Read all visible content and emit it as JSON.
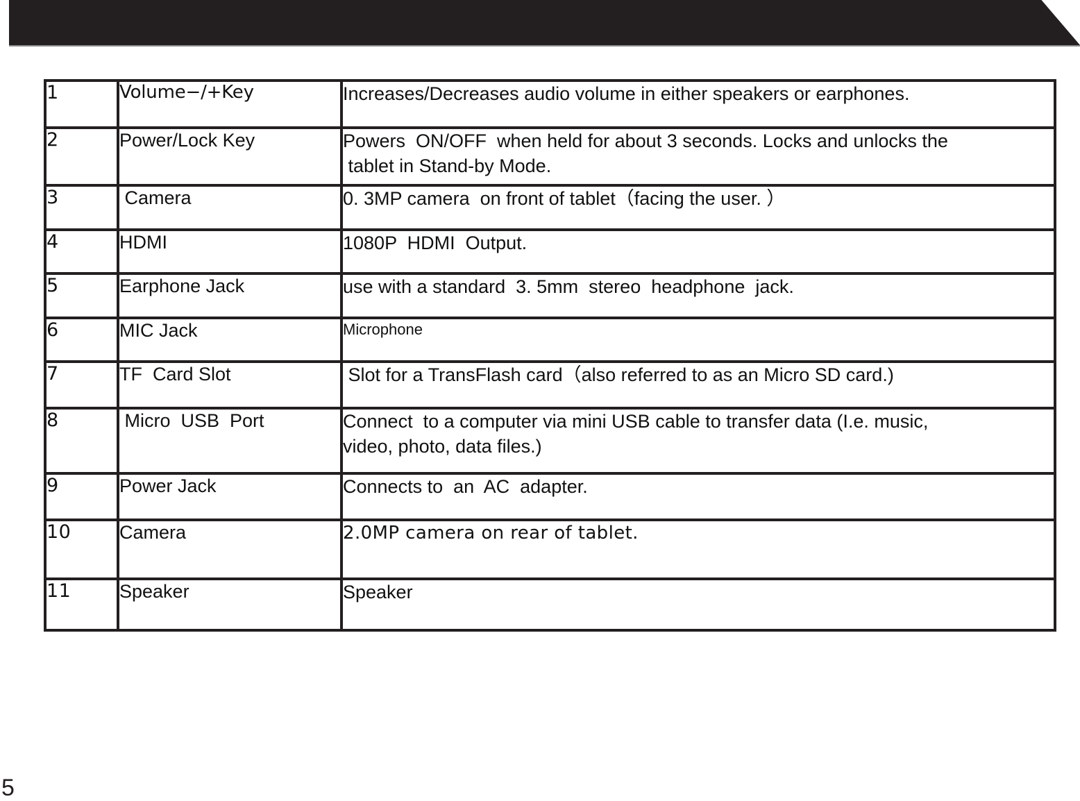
{
  "header": {
    "banner_color": "#231f20",
    "underline_color": "#8a8a8a"
  },
  "page": {
    "number": "5"
  },
  "table": {
    "border_color": "#231f20",
    "rows": [
      {
        "num": "1",
        "name": "Volume−/+Key",
        "desc": "Increases/Decreases audio volume in either speakers or earphones."
      },
      {
        "num": "2",
        "name": "Power/Lock Key",
        "desc": "Powers  ON/OFF  when held for about 3 seconds. Locks and unlocks the\n tablet in Stand-by Mode."
      },
      {
        "num": "3",
        "name": " Camera",
        "desc": "0. 3MP camera  on front of tablet（facing the user. ）"
      },
      {
        "num": "4",
        "name": "HDMI",
        "desc": "1080P  HDMI  Output."
      },
      {
        "num": "5",
        "name": "Earphone Jack",
        "desc": "use with a standard  3. 5mm  stereo  headphone  jack."
      },
      {
        "num": "6",
        "name": "MIC Jack",
        "desc": "Microphone"
      },
      {
        "num": "7",
        "name": "TF  Card Slot",
        "desc": " Slot for a TransFlash card（also referred to as an Micro SD card.)"
      },
      {
        "num": "8",
        "name": " Micro  USB  Port",
        "desc": "Connect  to a computer via mini USB cable to transfer data (I.e. music,\nvideo, photo, data files.)"
      },
      {
        "num": "9",
        "name": "Power Jack",
        "desc": "Connects to  an  AC  adapter."
      },
      {
        "num": "10",
        "name": "Camera",
        "desc": "2.0MP camera on rear of tablet."
      },
      {
        "num": "11",
        "name": "Speaker",
        "desc": "Speaker"
      }
    ]
  }
}
